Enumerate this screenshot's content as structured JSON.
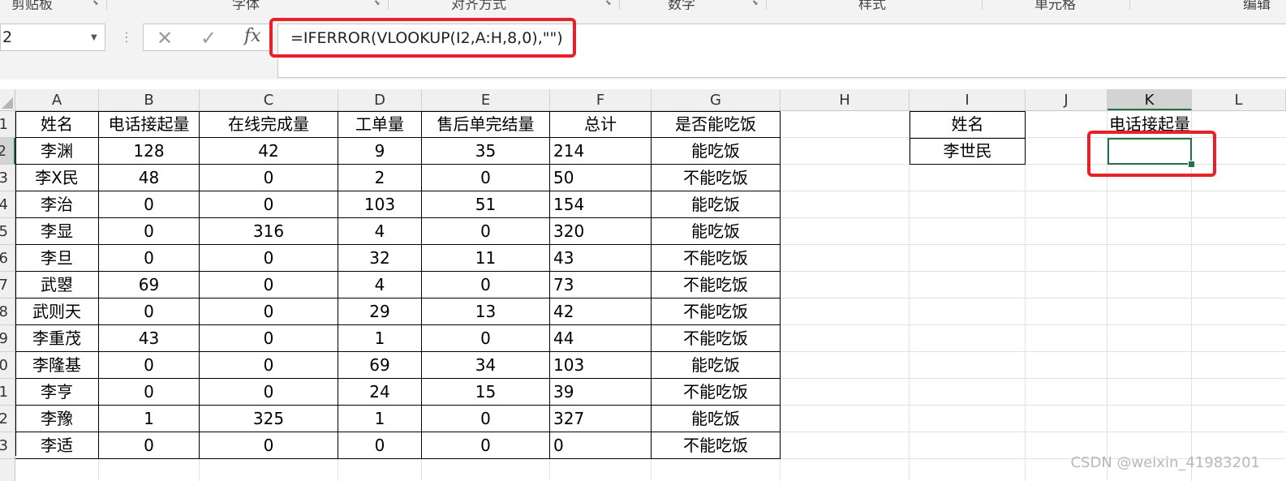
{
  "ribbon": {
    "groups": [
      "剪贴板",
      "字体",
      "对齐方式",
      "数字",
      "样式",
      "单元格",
      "编辑"
    ]
  },
  "formula_bar": {
    "name_box": "2",
    "cancel_icon": "✕",
    "enter_icon": "✓",
    "fx_label": "fx",
    "formula": "=IFERROR(VLOOKUP(I2,A:H,8,0),\"\")"
  },
  "columns": [
    "A",
    "B",
    "C",
    "D",
    "E",
    "F",
    "G",
    "H",
    "I",
    "J",
    "K",
    "L"
  ],
  "rows": [
    "1",
    "2",
    "3",
    "4",
    "5",
    "6",
    "7",
    "8",
    "9",
    "0",
    "1",
    "2",
    "3",
    ""
  ],
  "table": {
    "headers": [
      "姓名",
      "电话接起量",
      "在线完成量",
      "工单量",
      "售后单完结量",
      "总计",
      "是否能吃饭"
    ],
    "rows": [
      [
        "李渊",
        "128",
        "42",
        "9",
        "35",
        "214",
        "能吃饭"
      ],
      [
        "李X民",
        "48",
        "0",
        "2",
        "0",
        "50",
        "不能吃饭"
      ],
      [
        "李治",
        "0",
        "0",
        "103",
        "51",
        "154",
        "能吃饭"
      ],
      [
        "李显",
        "0",
        "316",
        "4",
        "0",
        "320",
        "能吃饭"
      ],
      [
        "李旦",
        "0",
        "0",
        "32",
        "11",
        "43",
        "不能吃饭"
      ],
      [
        "武曌",
        "69",
        "0",
        "4",
        "0",
        "73",
        "不能吃饭"
      ],
      [
        "武则天",
        "0",
        "0",
        "29",
        "13",
        "42",
        "不能吃饭"
      ],
      [
        "李重茂",
        "43",
        "0",
        "1",
        "0",
        "44",
        "不能吃饭"
      ],
      [
        "李隆基",
        "0",
        "0",
        "69",
        "34",
        "103",
        "能吃饭"
      ],
      [
        "李亨",
        "0",
        "0",
        "24",
        "15",
        "39",
        "不能吃饭"
      ],
      [
        "李豫",
        "1",
        "325",
        "1",
        "0",
        "327",
        "能吃饭"
      ],
      [
        "李适",
        "0",
        "0",
        "0",
        "0",
        "0",
        "不能吃饭"
      ]
    ]
  },
  "lookup": {
    "header": "姓名",
    "value": "李世民",
    "k_header": "电话接起量"
  },
  "watermark": "CSDN @weixin_41983201",
  "colors": {
    "accent": "#217346",
    "highlight": "#e8202a"
  }
}
